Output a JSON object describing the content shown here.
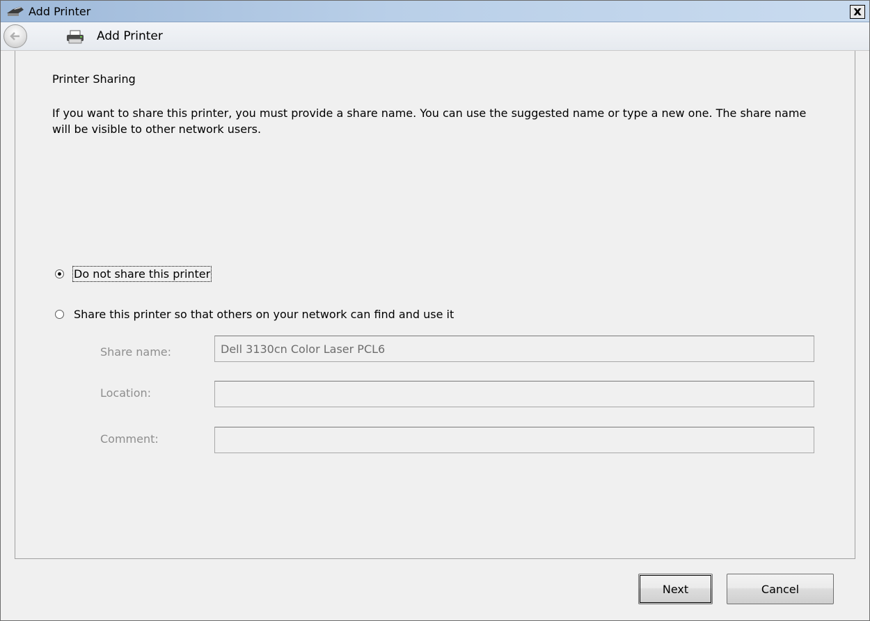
{
  "window": {
    "title": "Add Printer",
    "close_label": "x"
  },
  "nav": {
    "title": "Add Printer"
  },
  "page": {
    "heading": "Printer Sharing",
    "description": "If you want to share this printer, you must provide a share name. You can use the suggested name or type a new one. The share name will be visible to other network users."
  },
  "options": {
    "do_not_share": {
      "label": "Do not share this printer",
      "selected": true
    },
    "share": {
      "label": "Share this printer so that others on your network can find and use it",
      "selected": false
    }
  },
  "fields": {
    "share_name": {
      "label": "Share name:",
      "value": "Dell 3130cn Color Laser PCL6"
    },
    "location": {
      "label": "Location:",
      "value": ""
    },
    "comment": {
      "label": "Comment:",
      "value": ""
    }
  },
  "buttons": {
    "next": "Next",
    "cancel": "Cancel"
  }
}
